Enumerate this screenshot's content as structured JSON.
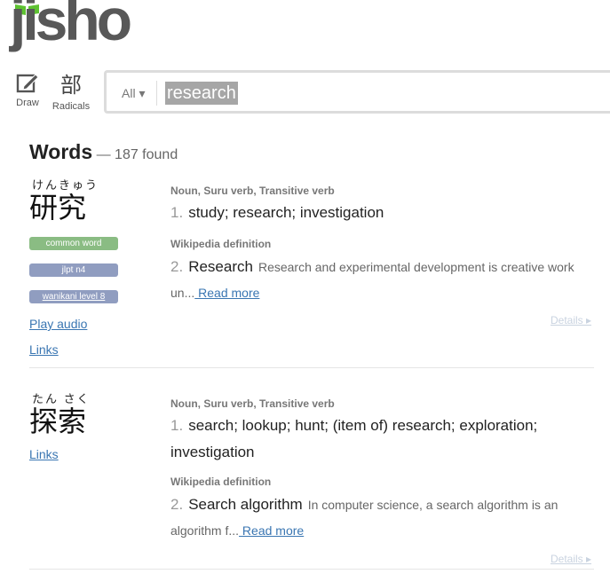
{
  "logo": {
    "text": "jisho",
    "leaf_color": "#5ec231"
  },
  "tools": {
    "draw_label": "Draw",
    "radicals_char": "部",
    "radicals_label": "Radicals"
  },
  "search": {
    "language": "All ▾",
    "query": "research"
  },
  "results_header": {
    "title": "Words",
    "count": "— 187 found"
  },
  "entries": [
    {
      "furigana": "けんきゅう",
      "word": "研究",
      "tags": [
        "common word",
        "jlpt n4",
        "wanikani level 8"
      ],
      "links": [
        "Play audio",
        "Links"
      ],
      "pos": "Noun, Suru verb, Transitive verb",
      "meaning_num": "1.",
      "meaning": "study; research; investigation",
      "wiki_label": "Wikipedia definition",
      "wiki_num": "2.",
      "wiki_title": "Research",
      "wiki_text": "Research and experimental development is creative work un...",
      "read_more": " Read more",
      "details": "Details ▸"
    },
    {
      "furigana": "たん さく",
      "word": "探索",
      "links": [
        "Links"
      ],
      "pos": "Noun, Suru verb, Transitive verb",
      "meaning_num": "1.",
      "meaning": "search; lookup; hunt; (item of) research; exploration; investigation",
      "wiki_label": "Wikipedia definition",
      "wiki_num": "2.",
      "wiki_title": "Search algorithm",
      "wiki_text": "In computer science, a search algorithm is an algorithm f...",
      "read_more": " Read more",
      "details": "Details ▸"
    }
  ]
}
